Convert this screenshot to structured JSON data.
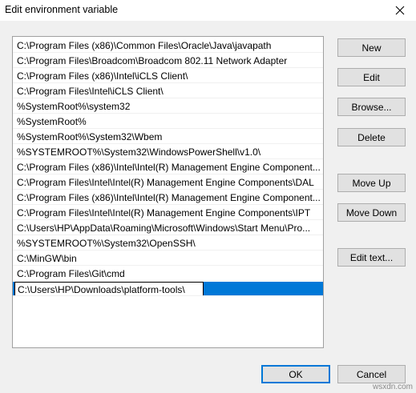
{
  "window": {
    "title": "Edit environment variable",
    "close_icon": "close-icon"
  },
  "list": {
    "items": [
      "C:\\Program Files (x86)\\Common Files\\Oracle\\Java\\javapath",
      "C:\\Program Files\\Broadcom\\Broadcom 802.11 Network Adapter",
      "C:\\Program Files (x86)\\Intel\\iCLS Client\\",
      "C:\\Program Files\\Intel\\iCLS Client\\",
      "%SystemRoot%\\system32",
      "%SystemRoot%",
      "%SystemRoot%\\System32\\Wbem",
      "%SYSTEMROOT%\\System32\\WindowsPowerShell\\v1.0\\",
      "C:\\Program Files (x86)\\Intel\\Intel(R) Management Engine Component...",
      "C:\\Program Files\\Intel\\Intel(R) Management Engine Components\\DAL",
      "C:\\Program Files (x86)\\Intel\\Intel(R) Management Engine Component...",
      "C:\\Program Files\\Intel\\Intel(R) Management Engine Components\\IPT",
      "C:\\Users\\HP\\AppData\\Roaming\\Microsoft\\Windows\\Start Menu\\Pro...",
      "%SYSTEMROOT%\\System32\\OpenSSH\\",
      "C:\\MinGW\\bin",
      "C:\\Program Files\\Git\\cmd"
    ],
    "editing_value": "C:\\Users\\HP\\Downloads\\platform-tools\\"
  },
  "buttons": {
    "new": "New",
    "edit": "Edit",
    "browse": "Browse...",
    "delete": "Delete",
    "move_up": "Move Up",
    "move_down": "Move Down",
    "edit_text": "Edit text...",
    "ok": "OK",
    "cancel": "Cancel"
  },
  "colors": {
    "selection": "#0078d7",
    "background": "#f0f0f0"
  },
  "watermark": "wsxdn.com"
}
